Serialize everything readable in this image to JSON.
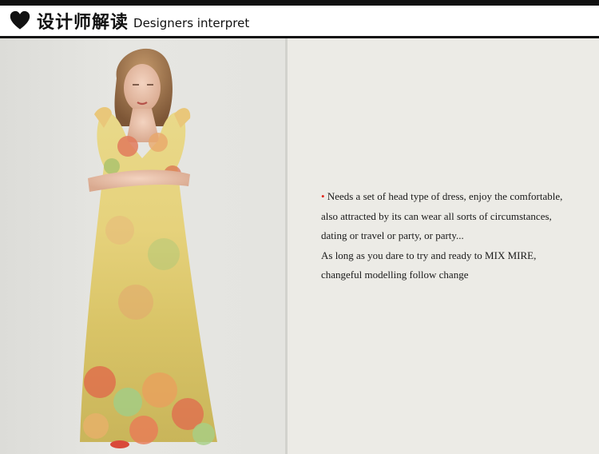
{
  "header": {
    "title_cn": "设计师解读",
    "title_en": "Designers interpret"
  },
  "description": {
    "lines": [
      "Needs a set of head type of dress, enjoy the comfortable,",
      " also attracted by its can wear all sorts of circumstances,",
      "dating or travel or party, or party...",
      "As long as you dare to try and ready to MIX MIRE,",
      "changeful modelling follow change"
    ],
    "bullet": "•"
  },
  "colors": {
    "accent": "#e0261c",
    "bar": "#111111",
    "background": "#ecebe6"
  },
  "icons": {
    "header": "heart-icon"
  }
}
